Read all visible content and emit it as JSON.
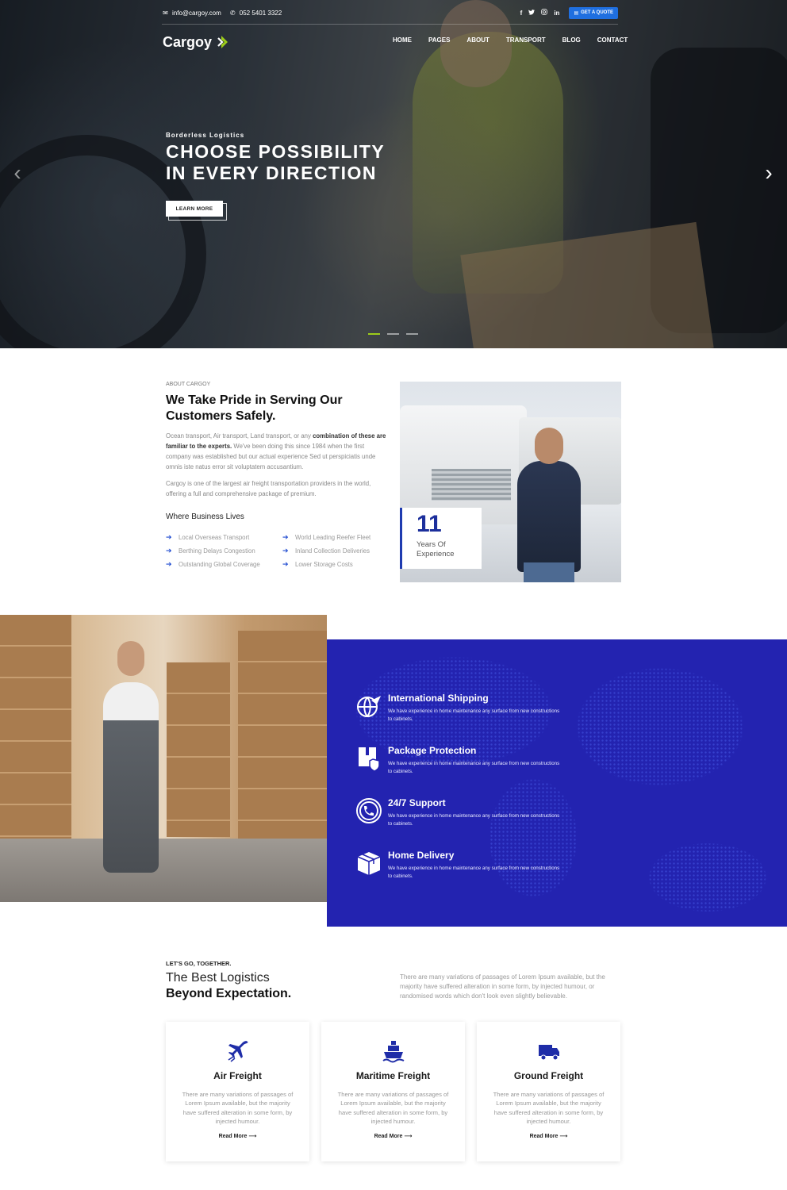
{
  "topbar": {
    "email": "info@cargoy.com",
    "phone": "052 5401 3322",
    "social": [
      "f",
      "t",
      "ig",
      "in"
    ],
    "quote_label": "GET A QUOTE"
  },
  "brand": {
    "name": "Cargoy",
    "accent": "#9ccc1a",
    "primary": "#2323b0",
    "button": "#1f6fe0"
  },
  "nav": [
    "HOME",
    "PAGES",
    "ABOUT",
    "TRANSPORT",
    "BLOG",
    "CONTACT"
  ],
  "hero": {
    "eyebrow": "Borderless Logistics",
    "title_line1": "CHOOSE POSSIBILITY",
    "title_line2": "IN EVERY DIRECTION",
    "button": "LEARN MORE",
    "slides": 3,
    "active_slide": 1
  },
  "about": {
    "eyebrow": "ABOUT CARGOY",
    "title_line1": "We Take Pride in Serving Our",
    "title_line2": "Customers Safely.",
    "p1_pre": "Ocean transport, Air transport, Land transport, or any ",
    "p1_bold": "combination of these are familiar to the experts.",
    "p1_post": " We've been doing this since 1984 when the first company was established but our actual experience Sed ut perspiciatis unde omnis iste natus error sit voluptatem accusantium.",
    "p2": "Cargoy is one of the largest air freight transportation providers in the world, offering a full and comprehensive package of premium.",
    "business_title": "Where Business Lives",
    "business_items": [
      "Local Overseas Transport",
      "World Leading Reefer Fleet",
      "Berthing Delays Congestion",
      "Inland Collection Deliveries",
      "Outstanding Global Coverage",
      "Lower Storage Costs"
    ],
    "experience_number": "11",
    "experience_label": "Years Of Experience"
  },
  "features": [
    {
      "icon": "globe-plane-icon",
      "title": "International Shipping",
      "desc": "We have experience in home maintenance any surface from new constructions to cabinets."
    },
    {
      "icon": "package-shield-icon",
      "title": "Package Protection",
      "desc": "We have experience in home maintenance any surface from new constructions to cabinets."
    },
    {
      "icon": "phone-support-icon",
      "title": "24/7 Support",
      "desc": "We have experience in home maintenance any surface from new constructions to cabinets."
    },
    {
      "icon": "box-delivery-icon",
      "title": "Home Delivery",
      "desc": "We have experience in home maintenance any surface from new constructions to cabinets."
    }
  ],
  "logistics": {
    "eyebrow": "LET'S GO, TOGETHER.",
    "title_line1": "The Best Logistics",
    "title_line2": "Beyond Expectation.",
    "paragraph": "There are many variations of passages of Lorem Ipsum available, but the majority have suffered alteration in some form, by injected humour, or randomised words which don't look even slightly believable.",
    "cards": [
      {
        "icon": "airplane-icon",
        "title": "Air Freight",
        "desc": "There are many variations of passages of Lorem Ipsum available, but the majority have suffered alteration in some form, by injected humour.",
        "link": "Read More"
      },
      {
        "icon": "ship-icon",
        "title": "Maritime Freight",
        "desc": "There are many variations of passages of Lorem Ipsum available, but the majority have suffered alteration in some form, by injected humour.",
        "link": "Read More"
      },
      {
        "icon": "truck-icon",
        "title": "Ground Freight",
        "desc": "There are many variations of passages of Lorem Ipsum available, but the majority have suffered alteration in some form, by injected humour.",
        "link": "Read More"
      }
    ]
  }
}
